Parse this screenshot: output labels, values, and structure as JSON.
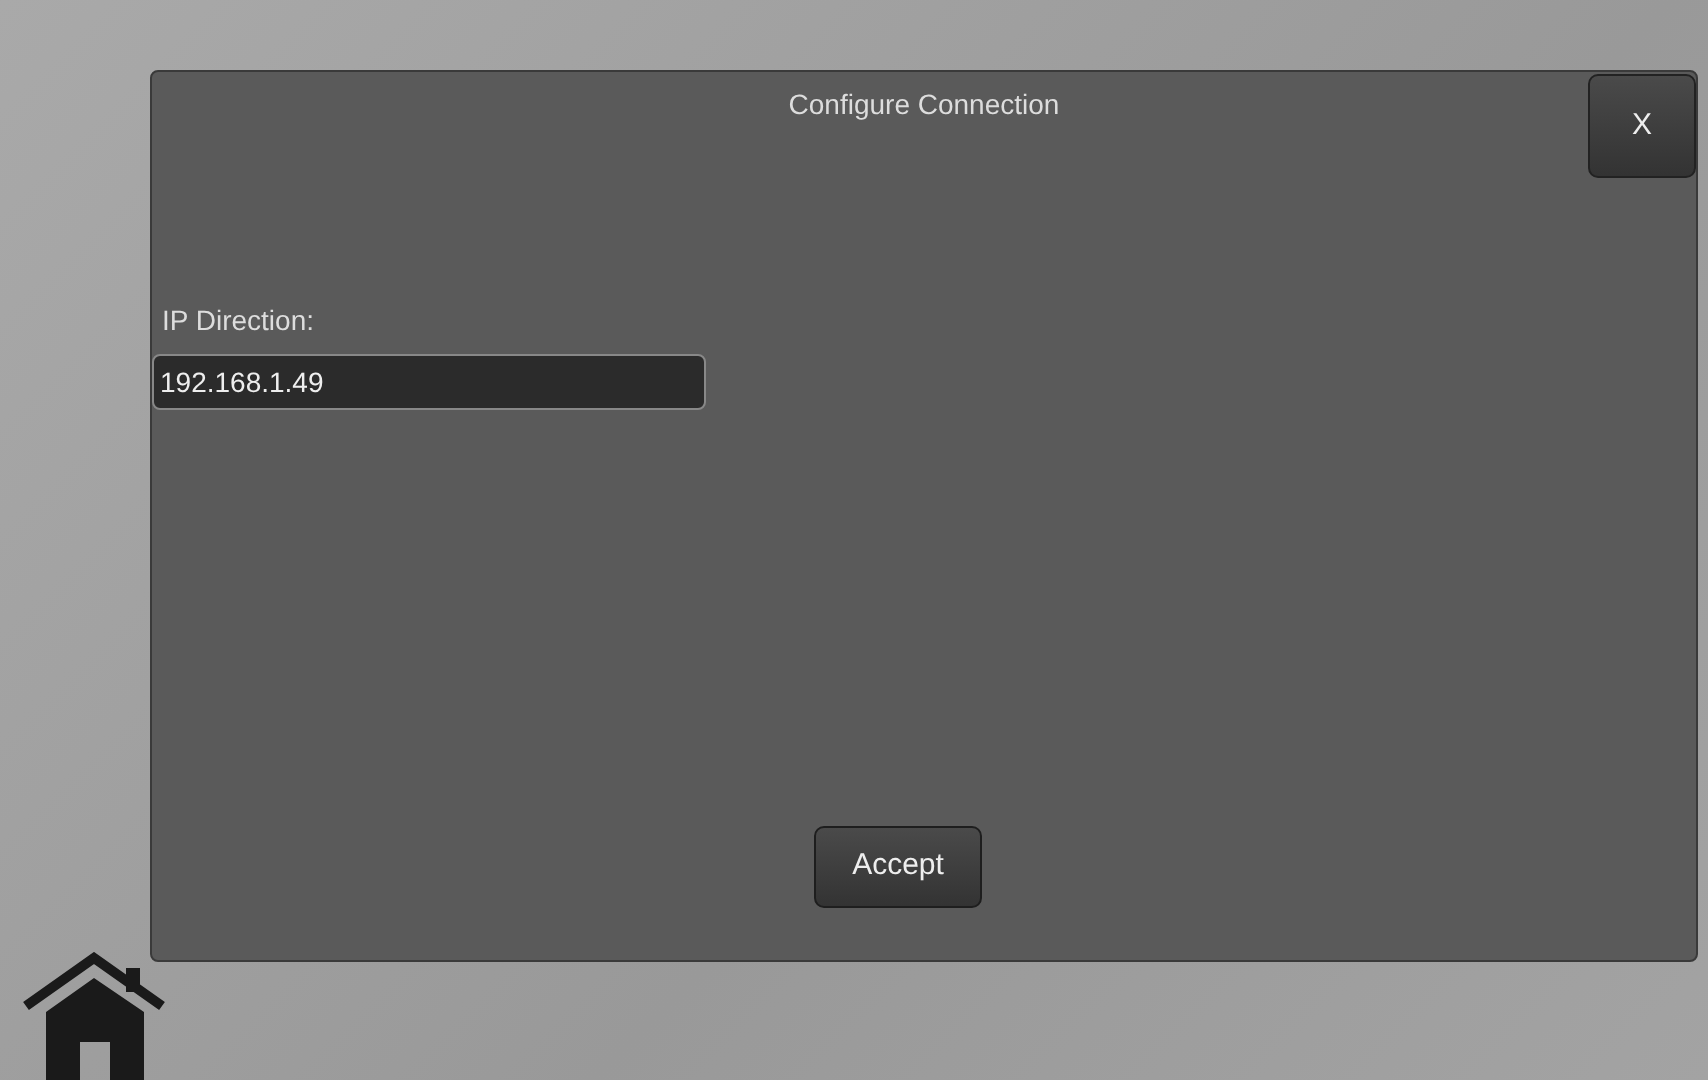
{
  "dialog": {
    "title": "Configure Connection",
    "close_label": "X",
    "field": {
      "label": "IP Direction:",
      "value": "192.168.1.49"
    },
    "accept_label": "Accept"
  }
}
